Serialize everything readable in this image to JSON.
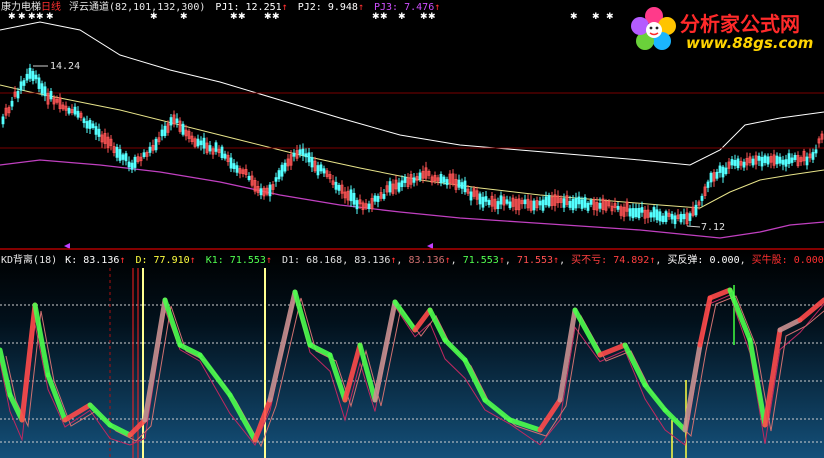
{
  "top_bar": {
    "stock_name": "康力电梯",
    "period": "日线",
    "indicator_name": "浮云通道",
    "indicator_params": "(82,101,132,300)",
    "pj1_label": "PJ1:",
    "pj1_value": "12.251",
    "pj2_label": "PJ2:",
    "pj2_value": "9.948",
    "pj3_label": "PJ3:",
    "pj3_value": "7.476",
    "up_arrow": "↑"
  },
  "price_panel": {
    "high_marker": "14.24",
    "low_marker": "7.12"
  },
  "kd_bar": {
    "name": "KD背离",
    "params": "(18)",
    "k_label": "K:",
    "k_value": "83.136",
    "d_label": "D:",
    "d_value": "77.910",
    "k1_label": "K1:",
    "k1_value": "71.553",
    "d1_label": "D1:",
    "d1_value": "68.168",
    "v1": "83.136",
    "v2": "83.136",
    "v3": "71.553",
    "v4": "71.553",
    "buy_nl_label": "买不亏:",
    "buy_nl_value": "74.892",
    "buy_rebound_label": "买反弹:",
    "buy_rebound_value": "0.000",
    "buy_bull_label": "买牛股:",
    "buy_bull_value": "0.000",
    "up_arrow": "↑"
  },
  "watermark": {
    "site_name": "分析家公式网",
    "site_url": "www.88gs.com"
  },
  "colors": {
    "background": "#000000",
    "candle_up": "#ff5555",
    "candle_down": "#54ffff",
    "upper_channel": "#ffffff",
    "mid_channel": "#e8e48a",
    "lower_channel": "#c040c0",
    "k_line_up": "#ff4444",
    "k_line_down": "#44ff44",
    "separator": "#a00000",
    "kd_bg_top": "#000000",
    "kd_bg_bottom": "#11476e"
  }
}
